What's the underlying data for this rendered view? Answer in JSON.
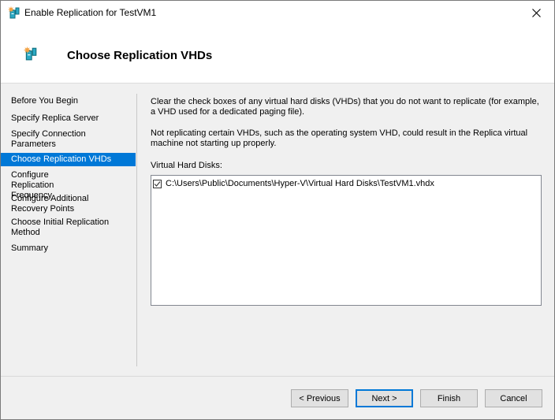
{
  "window": {
    "title": "Enable Replication for TestVM1",
    "icon": "hyper-v-replication-icon",
    "close_icon": "close-icon"
  },
  "header": {
    "title": "Choose Replication VHDs",
    "icon": "hyper-v-replication-icon"
  },
  "sidebar": {
    "steps": [
      {
        "label": "Before You Begin",
        "active": false
      },
      {
        "label": "Specify Replica Server",
        "active": false
      },
      {
        "label": "Specify Connection Parameters",
        "active": false
      },
      {
        "label": "Choose Replication VHDs",
        "active": true
      },
      {
        "label": "Configure Replication Frequency",
        "active": false
      },
      {
        "label": "Configure Additional Recovery Points",
        "active": false
      },
      {
        "label": "Choose Initial Replication Method",
        "active": false
      },
      {
        "label": "Summary",
        "active": false
      }
    ]
  },
  "content": {
    "instruction": "Clear the check boxes of any virtual hard disks (VHDs) that you do not want to replicate (for example, a VHD used for a dedicated paging file).",
    "warning": "Not replicating certain VHDs, such as the operating system VHD, could result in the Replica virtual machine not starting up properly.",
    "vhd_label": "Virtual Hard Disks:",
    "vhds": [
      {
        "path": "C:\\Users\\Public\\Documents\\Hyper-V\\Virtual Hard Disks\\TestVM1.vhdx",
        "checked": true
      }
    ]
  },
  "buttons": {
    "previous": "< Previous",
    "next": "Next >",
    "finish": "Finish",
    "cancel": "Cancel"
  },
  "colors": {
    "accent": "#0078d7",
    "selected_text": "#ffffff"
  }
}
